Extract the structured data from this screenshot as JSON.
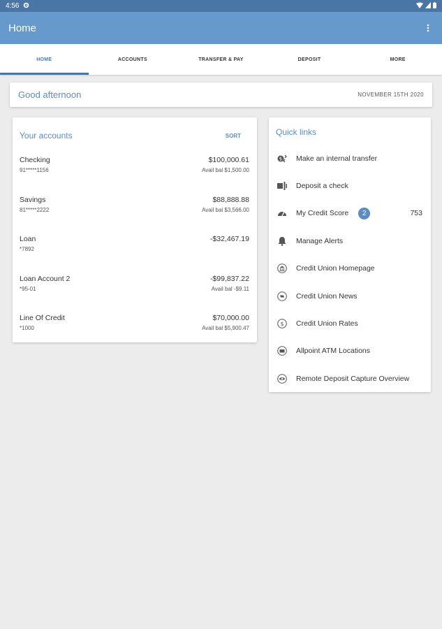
{
  "status_bar": {
    "time": "4:56"
  },
  "app_bar": {
    "title": "Home"
  },
  "tabs": [
    {
      "label": "HOME",
      "active": true
    },
    {
      "label": "ACCOUNTS",
      "active": false
    },
    {
      "label": "TRANSFER & PAY",
      "active": false
    },
    {
      "label": "DEPOSIT",
      "active": false
    },
    {
      "label": "MORE",
      "active": false
    }
  ],
  "greeting": {
    "text": "Good afternoon",
    "date": "NOVEMBER 15TH 2020"
  },
  "accounts": {
    "title": "Your accounts",
    "sort_label": "SORT",
    "items": [
      {
        "name": "Checking",
        "number": "91*****1156",
        "balance": "$100,000.61",
        "available": "Avail bal $1,500.00"
      },
      {
        "name": "Savings",
        "number": "81*****2222",
        "balance": "$88,888.88",
        "available": "Avail bal $3,566.00"
      },
      {
        "name": "Loan",
        "number": "*7892",
        "balance": "-$32,467.19",
        "available": ""
      },
      {
        "name": "Loan Account 2",
        "number": "*95-01",
        "balance": "-$99,837.22",
        "available": "Avail bal -$9.11"
      },
      {
        "name": "Line Of Credit",
        "number": "*1000",
        "balance": "$70,000.00",
        "available": "Avail bal $5,900.47"
      }
    ]
  },
  "quick_links": {
    "title": "Quick links",
    "items": [
      {
        "label": "Make an internal transfer",
        "icon": "transfer-icon"
      },
      {
        "label": "Deposit a check",
        "icon": "check-deposit-icon"
      },
      {
        "label": "My Credit Score",
        "icon": "gauge-icon",
        "badge": "2",
        "value": "753"
      },
      {
        "label": "Manage Alerts",
        "icon": "bell-icon"
      },
      {
        "label": "Credit Union Homepage",
        "icon": "bank-icon"
      },
      {
        "label": "Credit Union News",
        "icon": "news-icon"
      },
      {
        "label": "Credit Union Rates",
        "icon": "dollar-icon"
      },
      {
        "label": "Allpoint ATM Locations",
        "icon": "atm-icon"
      },
      {
        "label": "Remote Deposit Capture Overview",
        "icon": "eye-icon"
      }
    ]
  },
  "colors": {
    "status_bar": "#4a76a6",
    "app_bar": "#6699cc",
    "accent": "#5b8cc4",
    "background": "#ececec"
  }
}
